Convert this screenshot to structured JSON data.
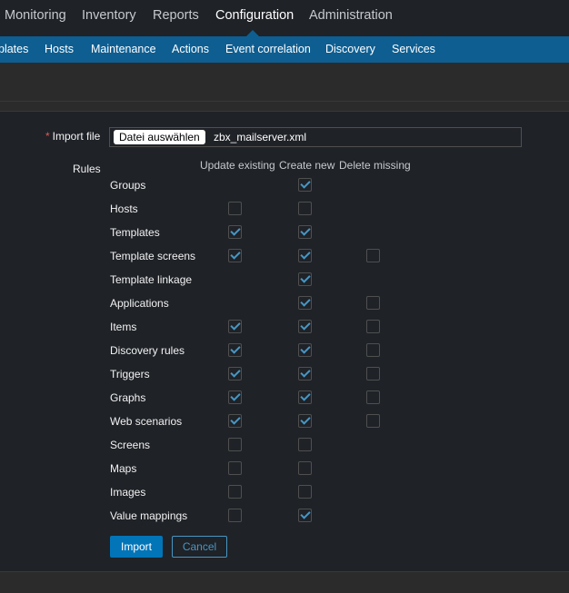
{
  "topnav": {
    "items": [
      "Monitoring",
      "Inventory",
      "Reports",
      "Configuration",
      "Administration"
    ],
    "active": "Configuration"
  },
  "subnav": {
    "items": [
      "plates",
      "Hosts",
      "Maintenance",
      "Actions",
      "Event correlation",
      "Discovery",
      "Services"
    ]
  },
  "form": {
    "import_file_label": "Import file",
    "required_marker": "*",
    "file_button_label": "Datei auswählen",
    "file_name": "zbx_mailserver.xml",
    "rules_label": "Rules",
    "columns": [
      "Update existing",
      "Create new",
      "Delete missing"
    ],
    "rules": [
      {
        "name": "Groups",
        "update": null,
        "create": true,
        "delete": null
      },
      {
        "name": "Hosts",
        "update": false,
        "create": false,
        "delete": null
      },
      {
        "name": "Templates",
        "update": true,
        "create": true,
        "delete": null
      },
      {
        "name": "Template screens",
        "update": true,
        "create": true,
        "delete": false
      },
      {
        "name": "Template linkage",
        "update": null,
        "create": true,
        "delete": null
      },
      {
        "name": "Applications",
        "update": null,
        "create": true,
        "delete": false
      },
      {
        "name": "Items",
        "update": true,
        "create": true,
        "delete": false
      },
      {
        "name": "Discovery rules",
        "update": true,
        "create": true,
        "delete": false
      },
      {
        "name": "Triggers",
        "update": true,
        "create": true,
        "delete": false
      },
      {
        "name": "Graphs",
        "update": true,
        "create": true,
        "delete": false
      },
      {
        "name": "Web scenarios",
        "update": true,
        "create": true,
        "delete": false
      },
      {
        "name": "Screens",
        "update": false,
        "create": false,
        "delete": null
      },
      {
        "name": "Maps",
        "update": false,
        "create": false,
        "delete": null
      },
      {
        "name": "Images",
        "update": false,
        "create": false,
        "delete": null
      },
      {
        "name": "Value mappings",
        "update": false,
        "create": true,
        "delete": null
      }
    ],
    "import_button": "Import",
    "cancel_button": "Cancel"
  },
  "colors": {
    "subnav_bg": "#0e5e91",
    "accent": "#0275b8",
    "check": "#4796c4",
    "required": "#e45959"
  }
}
